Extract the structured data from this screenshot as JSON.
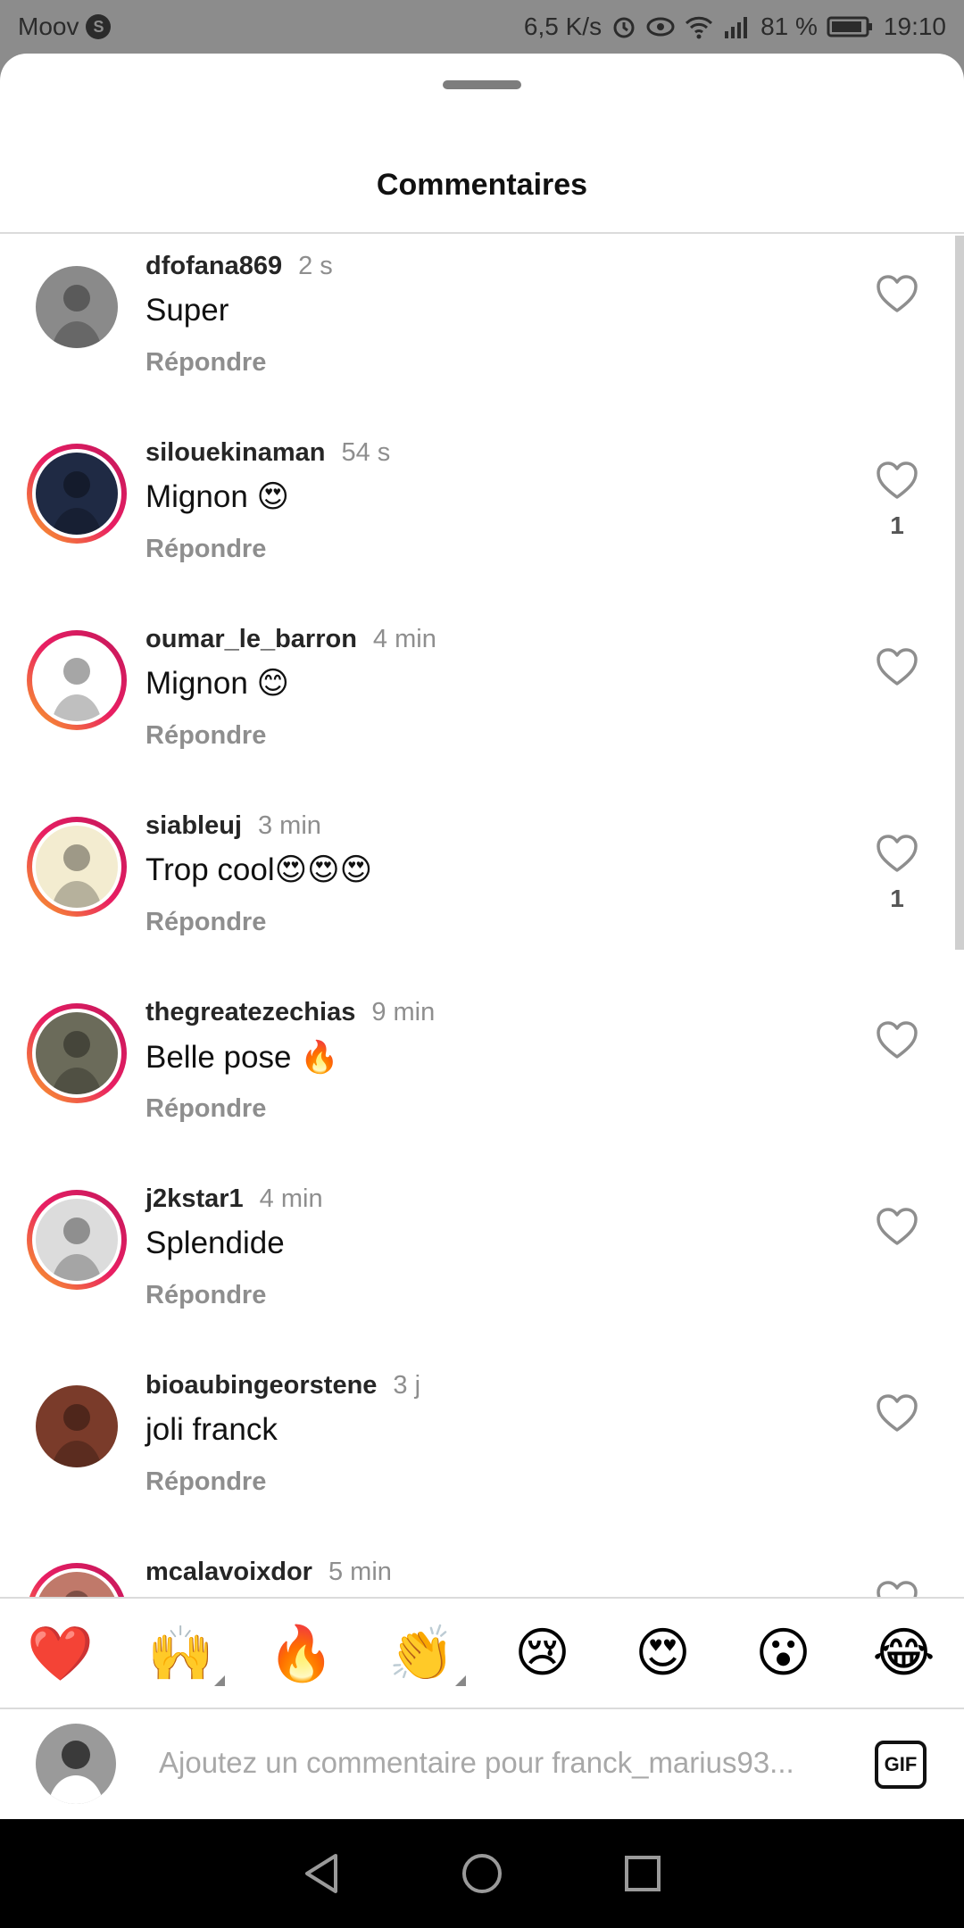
{
  "status_bar": {
    "carrier": "Moov",
    "carrier_badge": "S",
    "net_speed": "6,5 K/s",
    "battery": "81 %",
    "time": "19:10"
  },
  "sheet": {
    "title": "Commentaires"
  },
  "comments": [
    {
      "username": "dfofana869",
      "time": "2 s",
      "text": "Super",
      "reply": "Répondre",
      "likes": "",
      "story_ring": false,
      "avatar_color": "#8a8a8a"
    },
    {
      "username": "silouekinaman",
      "time": "54 s",
      "text": "Mignon 😍",
      "reply": "Répondre",
      "likes": "1",
      "story_ring": true,
      "avatar_color": "#1f2a44"
    },
    {
      "username": "oumar_le_barron",
      "time": "4 min",
      "text": "Mignon 😊",
      "reply": "Répondre",
      "likes": "",
      "story_ring": true,
      "avatar_color": "#ffffff"
    },
    {
      "username": "siableuj",
      "time": "3 min",
      "text": "Trop cool😍😍😍",
      "reply": "Répondre",
      "likes": "1",
      "story_ring": true,
      "avatar_color": "#f3ecd0"
    },
    {
      "username": "thegreatezechias",
      "time": "9 min",
      "text": "Belle pose 🔥",
      "reply": "Répondre",
      "likes": "",
      "story_ring": true,
      "avatar_color": "#6b6b5a"
    },
    {
      "username": "j2kstar1",
      "time": "4 min",
      "text": "Splendide",
      "reply": "Répondre",
      "likes": "",
      "story_ring": true,
      "avatar_color": "#dcdcdc"
    },
    {
      "username": "bioaubingeorstene",
      "time": "3 j",
      "text": "joli franck",
      "reply": "Répondre",
      "likes": "",
      "story_ring": false,
      "avatar_color": "#7a3b2a"
    },
    {
      "username": "mcalavoixdor",
      "time": "5 min",
      "text": "",
      "reply": "",
      "likes": "",
      "story_ring": true,
      "avatar_color": "#c0796a"
    }
  ],
  "emoji_bar": [
    "❤️",
    "🙌",
    "🔥",
    "👏",
    "😢",
    "😍",
    "😮",
    "😂"
  ],
  "input": {
    "placeholder": "Ajoutez un commentaire pour franck_marius93...",
    "gif_label": "GIF"
  },
  "colors": {
    "accent_gradient_start": "#f9a825",
    "accent_gradient_end": "#c2185b",
    "heart_red": "#ed4956"
  }
}
